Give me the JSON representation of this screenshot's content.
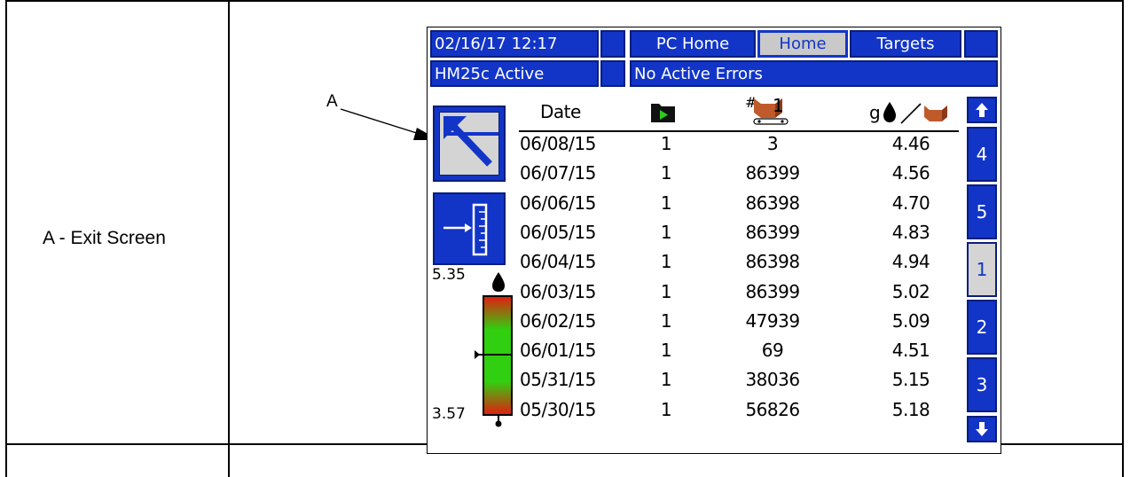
{
  "legend": {
    "callout_letter": "A",
    "label": "A - Exit Screen"
  },
  "topbar": {
    "datetime": "02/16/17 12:17",
    "tab_pc_home": "PC Home",
    "tab_home": "Home",
    "tab_targets": "Targets"
  },
  "statusbar": {
    "system": "HM25c Active",
    "errors": "No Active Errors"
  },
  "table": {
    "col_date": "Date",
    "col_job": "play-folder-icon",
    "col_cycles_prefix": "#",
    "col_cycles_suffix": "1",
    "col_rate_prefix": "g",
    "rows": [
      {
        "date": "06/08/15",
        "job": "1",
        "cycles": "3",
        "rate": "4.46"
      },
      {
        "date": "06/07/15",
        "job": "1",
        "cycles": "86399",
        "rate": "4.56"
      },
      {
        "date": "06/06/15",
        "job": "1",
        "cycles": "86398",
        "rate": "4.70"
      },
      {
        "date": "06/05/15",
        "job": "1",
        "cycles": "86399",
        "rate": "4.83"
      },
      {
        "date": "06/04/15",
        "job": "1",
        "cycles": "86398",
        "rate": "4.94"
      },
      {
        "date": "06/03/15",
        "job": "1",
        "cycles": "86399",
        "rate": "5.02"
      },
      {
        "date": "06/02/15",
        "job": "1",
        "cycles": "47939",
        "rate": "5.09"
      },
      {
        "date": "06/01/15",
        "job": "1",
        "cycles": "69",
        "rate": "4.51"
      },
      {
        "date": "05/31/15",
        "job": "1",
        "cycles": "38036",
        "rate": "5.15"
      },
      {
        "date": "05/30/15",
        "job": "1",
        "cycles": "56826",
        "rate": "5.18"
      }
    ]
  },
  "gauge": {
    "max_label": "5.35",
    "min_label": "3.57",
    "colors": {
      "top": "#e02010",
      "mid": "#22d010",
      "bottom": "#e02010"
    }
  },
  "pages": {
    "items": [
      "4",
      "5",
      "1",
      "2",
      "3"
    ],
    "selected": "1"
  },
  "colors": {
    "bar_blue": "#1235c8",
    "selected_gray": "#c9c9c9"
  }
}
